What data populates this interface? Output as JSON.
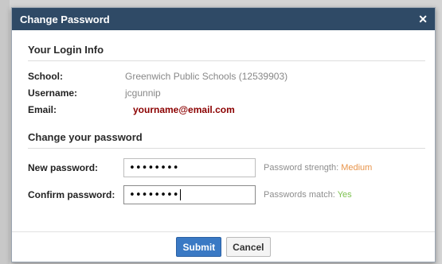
{
  "dialog": {
    "title": "Change Password",
    "close_icon": "close-icon"
  },
  "login_info": {
    "heading": "Your Login Info",
    "school_label": "School:",
    "school_value": "Greenwich Public Schools (12539903)",
    "username_label": "Username:",
    "username_value": "jcgunnip",
    "email_label": "Email:",
    "email_value": "yourname@email.com"
  },
  "change_password": {
    "heading": "Change your password",
    "new_password_label": "New password:",
    "new_password_value": "••••••••",
    "strength_label": "Password strength: ",
    "strength_value": "Medium",
    "confirm_password_label": "Confirm password:",
    "confirm_password_value": "••••••••",
    "match_label": "Passwords match: ",
    "match_value": "Yes"
  },
  "buttons": {
    "submit": "Submit",
    "cancel": "Cancel"
  },
  "colors": {
    "titlebar": "#2f4a66",
    "email": "#8b0000",
    "strength_medium": "#e8944a",
    "match_yes": "#7cc14e",
    "primary_button": "#3a79c4"
  }
}
